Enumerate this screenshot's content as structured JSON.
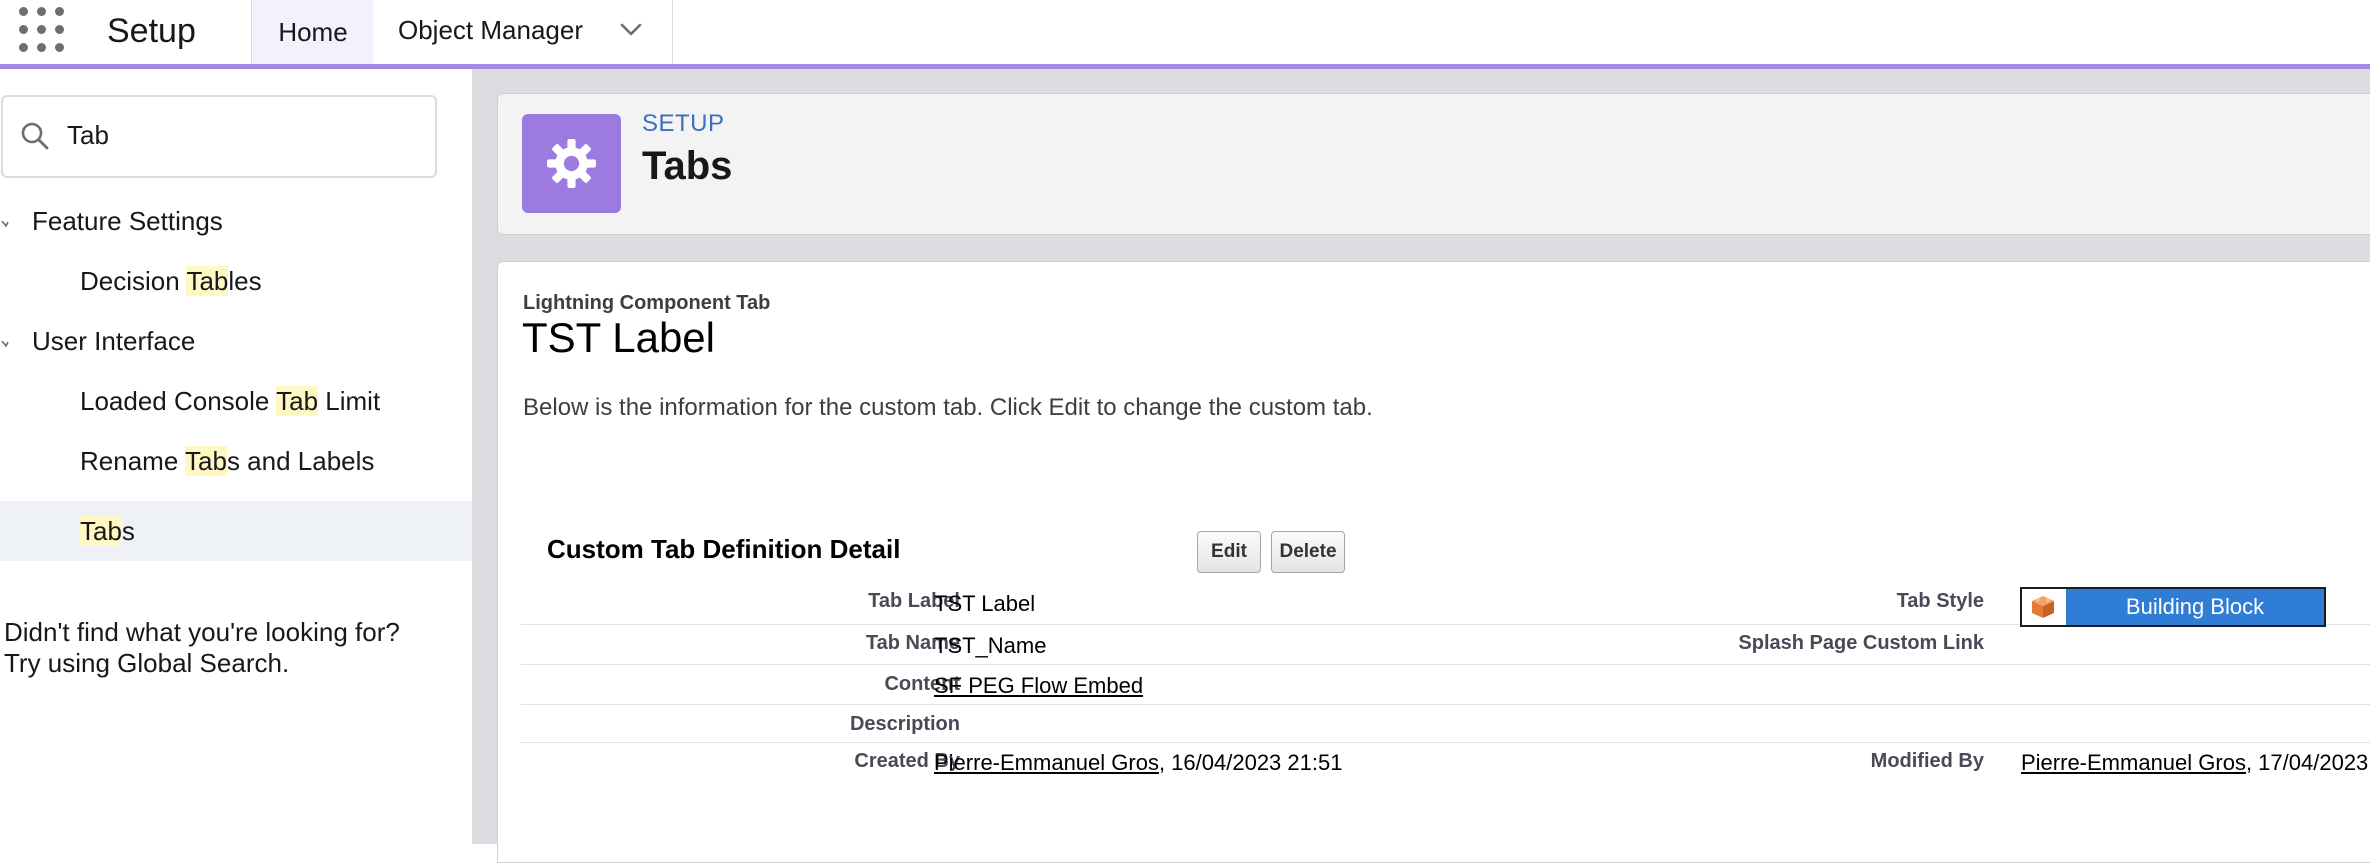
{
  "topbar": {
    "app_title": "Setup",
    "tabs": [
      {
        "label": "Home"
      },
      {
        "label": "Object Manager"
      }
    ],
    "accent_color": "#a889e2"
  },
  "sidebar": {
    "search": {
      "value": "Tab",
      "placeholder": ""
    },
    "tree": {
      "feature_settings": {
        "label": "Feature Settings",
        "items": [
          "Decision Tables"
        ]
      },
      "user_interface": {
        "label": "User Interface",
        "items": [
          "Loaded Console Tab Limit",
          "Rename Tabs and Labels",
          "Tabs"
        ]
      }
    },
    "item_parts": {
      "decision_tables": [
        "Decision ",
        "Tab",
        "les"
      ],
      "loaded_console": [
        "Loaded Console ",
        "Tab",
        " Limit"
      ],
      "rename_tabs": [
        "Rename ",
        "Tab",
        "s and Labels"
      ],
      "tabs": [
        "Tab",
        "s"
      ]
    },
    "selected_item": "Tabs",
    "help_line1": "Didn't find what you're looking for?",
    "help_line2": "Try using Global Search."
  },
  "header": {
    "eyebrow": "SETUP",
    "title": "Tabs",
    "icon": "gear-icon",
    "icon_color": "#9b7be0"
  },
  "detail": {
    "type_label": "Lightning Component Tab",
    "title": "TST Label",
    "description": "Below is the information for the custom tab. Click Edit to change the custom tab.",
    "section_title": "Custom Tab Definition Detail",
    "buttons": {
      "edit": "Edit",
      "delete": "Delete"
    },
    "fields": {
      "tab_label": {
        "label": "Tab Label",
        "value": "TST Label"
      },
      "tab_style": {
        "label": "Tab Style",
        "value": "Building Block",
        "color": "#2f7dd4",
        "icon": "building-block-icon"
      },
      "tab_name": {
        "label": "Tab Name",
        "value": "TST_Name"
      },
      "splash_page": {
        "label": "Splash Page Custom Link",
        "value": ""
      },
      "content": {
        "label": "Content",
        "value": "SF PEG Flow Embed"
      },
      "description": {
        "label": "Description",
        "value": ""
      },
      "created_by": {
        "label": "Created By",
        "user": "Pierre-Emmanuel Gros",
        "date": ", 16/04/2023 21:51"
      },
      "modified_by": {
        "label": "Modified By",
        "user": "Pierre-Emmanuel Gros",
        "date": ", 17/04/2023"
      }
    }
  }
}
